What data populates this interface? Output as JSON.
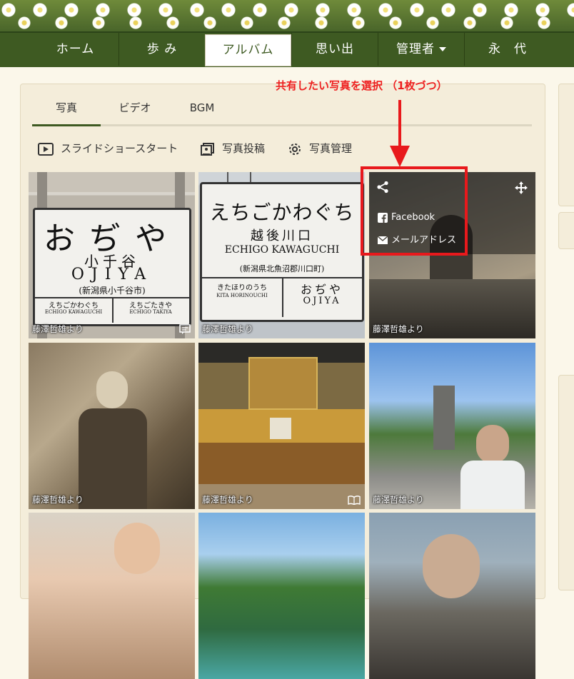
{
  "nav": {
    "items": [
      {
        "label": "ホーム"
      },
      {
        "label": "歩 み"
      },
      {
        "label": "アルバム"
      },
      {
        "label": "思い出"
      },
      {
        "label": "管理者"
      },
      {
        "label": "永　代"
      }
    ],
    "active": "アルバム"
  },
  "annotation": {
    "text": "共有したい写真を選択 （1枚づつ）",
    "color": "#ee1f1f"
  },
  "tabs": [
    {
      "label": "写真"
    },
    {
      "label": "ビデオ"
    },
    {
      "label": "BGM"
    }
  ],
  "active_tab": "写真",
  "toolbar": {
    "slideshow_label": "スライドショースタート",
    "upload_label": "写真投稿",
    "manage_label": "写真管理"
  },
  "share_menu": {
    "facebook_label": "Facebook",
    "mail_label": "メールアドレス"
  },
  "signs": {
    "ojiya": {
      "main": "おぢや",
      "kanji": "小千谷",
      "romaji": "OJIYA",
      "address": "(新潟県小千谷市)",
      "left_name": "えちごかわぐち",
      "left_romaji": "ECHIGO KAWAGUCHI",
      "right_name": "えちごたきや",
      "right_romaji": "ECHIGO TAKIYA"
    },
    "kawaguchi": {
      "main": "えちごかわぐち",
      "kanji": "越後川口",
      "romaji": "ECHIGO KAWAGUCHI",
      "address": "(新潟県北魚沼郡川口町)",
      "left_name": "きたほりのうち",
      "left_romaji": "KITA HORINOUCHI",
      "right_name": "おぢや",
      "right_romaji": "OJIYA"
    }
  },
  "photos": [
    {
      "caption": "藤澤哲雄より",
      "icon": "comment-icon"
    },
    {
      "caption": "藤澤哲雄より",
      "icon": ""
    },
    {
      "caption": "藤澤哲雄より",
      "icon": ""
    },
    {
      "caption": "藤澤哲雄より",
      "icon": ""
    },
    {
      "caption": "藤澤哲雄より",
      "icon": "book-icon"
    },
    {
      "caption": "藤澤哲雄より",
      "icon": ""
    }
  ],
  "colors": {
    "nav_bg": "#3e5a22",
    "panel_bg": "#f4edda",
    "highlight": "#e8191c"
  }
}
